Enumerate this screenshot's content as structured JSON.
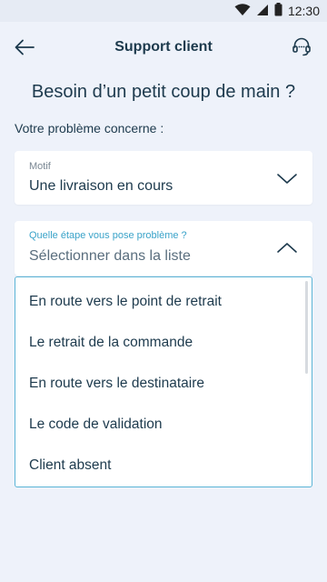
{
  "status_bar": {
    "time": "12:30",
    "icons": [
      "wifi-icon",
      "signal-icon",
      "battery-icon"
    ]
  },
  "app_bar": {
    "title": "Support client",
    "back_icon": "arrow-left-icon",
    "support_icon": "headset-icon"
  },
  "heading": "Besoin d’un petit coup de main ?",
  "subheading": "Votre problème concerne :",
  "motif_field": {
    "label": "Motif",
    "value": "Une livraison en cours",
    "icon": "chevron-down-icon"
  },
  "step_field": {
    "label": "Quelle étape vous pose problème ?",
    "placeholder": "Sélectionner dans la liste",
    "icon": "chevron-up-icon"
  },
  "dropdown": {
    "options": [
      "En route vers le point de retrait",
      "Le retrait de la commande",
      "En route vers le destinataire",
      "Le code de validation",
      "Client absent"
    ]
  },
  "colors": {
    "background": "#eef2fa",
    "primary_text": "#1d3a4d",
    "accent": "#3aa3c9",
    "dropdown_border": "#5bb4d6"
  }
}
